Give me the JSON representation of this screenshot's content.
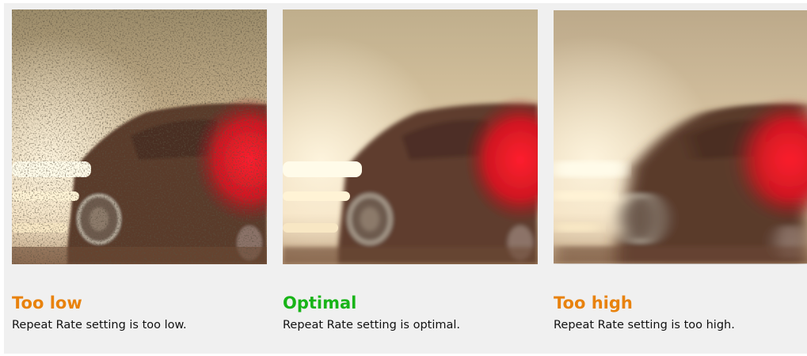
{
  "comparison": {
    "items": [
      {
        "title": "Too low",
        "title_color": "#e8820d",
        "description": "Repeat Rate setting is too low."
      },
      {
        "title": "Optimal",
        "title_color": "#18b418",
        "description": "Repeat Rate setting is optimal."
      },
      {
        "title": "Too high",
        "title_color": "#e8820d",
        "description": "Repeat Rate setting is too high."
      }
    ]
  }
}
